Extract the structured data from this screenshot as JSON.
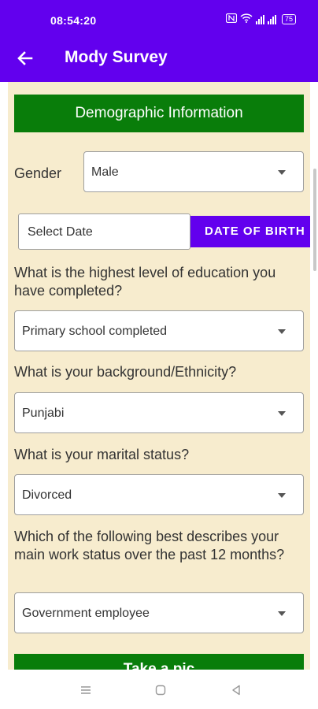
{
  "status_bar": {
    "time": "08:54:20",
    "battery": "75",
    "icons": [
      "nfc-icon",
      "wifi-icon",
      "signal-icon",
      "signal-icon",
      "battery-icon"
    ]
  },
  "app_bar": {
    "title": "Mody Survey",
    "back_icon": "arrow-left-icon"
  },
  "colors": {
    "primary": "#6200ee",
    "green": "#097d0a",
    "panel": "#f7ecce"
  },
  "form": {
    "section_header": "Demographic Information",
    "gender": {
      "label": "Gender",
      "value": "Male"
    },
    "date": {
      "placeholder": "Select Date",
      "button": "DATE OF BIRTH"
    },
    "education": {
      "label": "What is the highest level of education you have completed?",
      "value": "Primary school completed"
    },
    "ethnicity": {
      "label": "What is your background/Ethnicity?",
      "value": "Punjabi"
    },
    "marital": {
      "label": "What is your marital status?",
      "value": "Divorced"
    },
    "work": {
      "label": "Which of the following best describes your main work status over the past 12 months?",
      "value": "Government employee"
    },
    "submit_label": "Take a pic"
  },
  "nav_bar": {
    "icons": [
      "menu-icon",
      "home-square-icon",
      "back-triangle-icon"
    ]
  }
}
